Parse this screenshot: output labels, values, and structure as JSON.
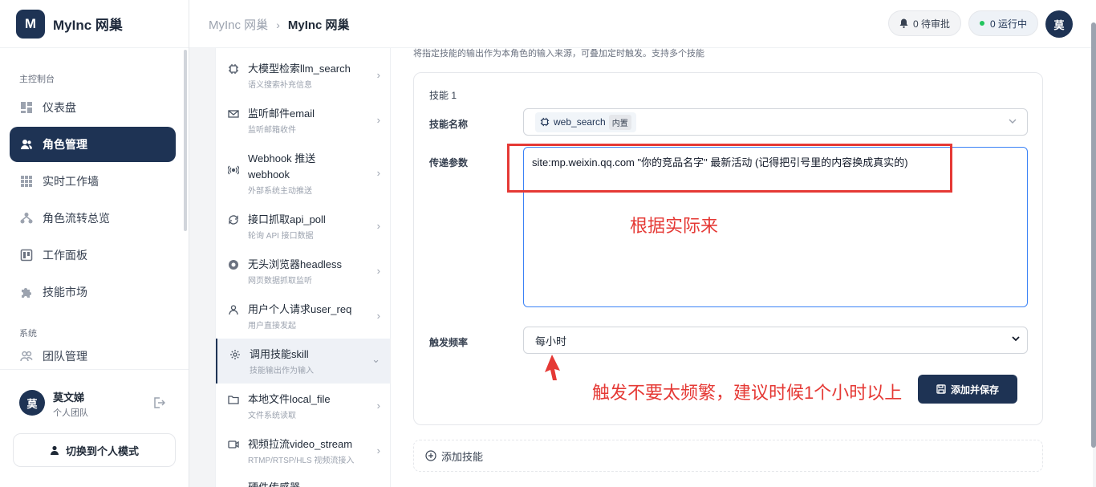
{
  "app": {
    "logo_letter": "M",
    "name": "MyInc 网巢"
  },
  "sidebar": {
    "section_main": "主控制台",
    "items": [
      {
        "label": "仪表盘",
        "icon": "dashboard-icon"
      },
      {
        "label": "角色管理",
        "icon": "users-icon"
      },
      {
        "label": "实时工作墙",
        "icon": "grid-icon"
      },
      {
        "label": "角色流转总览",
        "icon": "flow-icon"
      },
      {
        "label": "工作面板",
        "icon": "board-icon"
      },
      {
        "label": "技能市场",
        "icon": "puzzle-icon"
      }
    ],
    "section_system": "系统",
    "system_items": [
      {
        "label": "团队管理",
        "icon": "team-icon"
      }
    ],
    "user": {
      "avatar": "莫",
      "name": "莫文娣",
      "team": "个人团队"
    },
    "switch_label": "切换到个人模式"
  },
  "header": {
    "breadcrumb_parent": "MyInc 网巢",
    "breadcrumb_current": "MyInc 网巢",
    "pending": "0 待审批",
    "running": "0 运行中",
    "avatar": "莫"
  },
  "skill_list": [
    {
      "title": "大模型检索llm_search",
      "sub": "语义搜索补充信息",
      "icon": "chip-icon"
    },
    {
      "title": "监听邮件email",
      "sub": "监听邮箱收件",
      "icon": "mail-icon"
    },
    {
      "title": "Webhook 推送",
      "title2": "webhook",
      "sub": "外部系统主动推送",
      "icon": "broadcast-icon"
    },
    {
      "title": "接口抓取api_poll",
      "sub": "轮询 API 接口数据",
      "icon": "refresh-icon"
    },
    {
      "title": "无头浏览器headless",
      "sub": "网页数据抓取监听",
      "icon": "browser-icon"
    },
    {
      "title": "用户个人请求user_req",
      "sub": "用户直接发起",
      "icon": "user-icon"
    },
    {
      "title": "调用技能skill",
      "sub": "技能输出作为输入",
      "icon": "gear-icon"
    },
    {
      "title": "本地文件local_file",
      "sub": "文件系统读取",
      "icon": "folder-icon"
    },
    {
      "title": "视频拉流video_stream",
      "sub": "RTMP/RTSP/HLS 视频流接入",
      "icon": "video-icon"
    },
    {
      "title": "硬件传感器",
      "sub": "",
      "icon": "sensor-icon"
    }
  ],
  "main": {
    "hint": "将指定技能的输出作为本角色的输入来源，可叠加定时触发。支持多个技能",
    "card_title": "技能 1",
    "skill_name_label": "技能名称",
    "skill_value": "web_search",
    "skill_tag": "内置",
    "params_label": "传递参数",
    "params_value": "site:mp.weixin.qq.com \"你的竞品名字\" 最新活动 (记得把引号里的内容换成真实的)",
    "freq_label": "触发频率",
    "freq_value": "每小时",
    "save_label": "添加并保存",
    "add_skill_label": "添加技能"
  },
  "annotations": {
    "note1": "根据实际来",
    "note2": "触发不要太频繁，建议时候1个小时以上",
    "color": "#e53935"
  }
}
